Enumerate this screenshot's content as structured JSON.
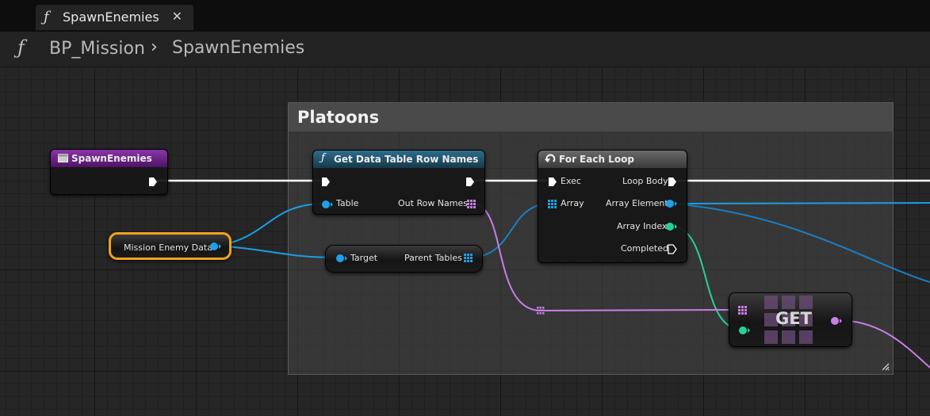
{
  "tab": {
    "icon": "function-icon",
    "label": "SpawnEnemies",
    "close": "✕"
  },
  "breadcrumb": {
    "icon": "function-icon",
    "items": [
      "BP_Mission",
      "SpawnEnemies"
    ],
    "separator": "›"
  },
  "comment": {
    "title": "Platoons"
  },
  "nodes": {
    "entry": {
      "title": "SpawnEnemies",
      "color": "#6e1c8a"
    },
    "mission_var": {
      "label": "Mission Enemy Data",
      "selected_color": "#f0a11c"
    },
    "get_rows": {
      "title": "Get Data Table Row Names",
      "in_table": "Table",
      "out_rows": "Out Row Names",
      "color": "#1f4f66"
    },
    "parent_tables": {
      "in_target": "Target",
      "out_tables": "Parent Tables"
    },
    "foreach": {
      "title": "For Each Loop",
      "in_exec": "Exec",
      "in_array": "Array",
      "out_body": "Loop Body",
      "out_element": "Array Element",
      "out_index": "Array Index",
      "out_completed": "Completed",
      "color": "#4a4a4a"
    },
    "get": {
      "label": "GET"
    }
  },
  "colors": {
    "exec": "#ffffff",
    "object": "#1fa0e8",
    "int": "#27d09a",
    "name_array": "#c77fe6",
    "struct": "#1f7fc4"
  }
}
